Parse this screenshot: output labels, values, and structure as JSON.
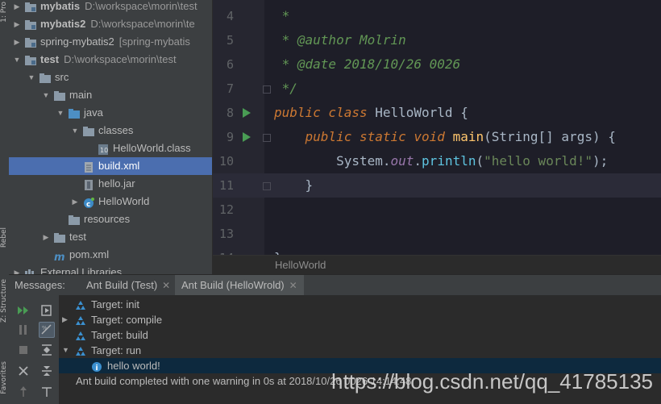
{
  "left_strip": {
    "top_label": "1: Pro",
    "middle_label": "Z: Structure",
    "bottom_label": "Favorites",
    "maven_label": "Rebel"
  },
  "project_tree": [
    {
      "label": "mybatis",
      "path": "D:\\workspace\\morin\\test",
      "icon": "module-folder-icon",
      "indent": 0,
      "expanded": false,
      "bold": true
    },
    {
      "label": "mybatis2",
      "path": "D:\\workspace\\morin\\te",
      "icon": "module-folder-icon",
      "indent": 0,
      "expanded": false,
      "bold": true
    },
    {
      "label": "spring-mybatis2",
      "path": "[spring-mybatis",
      "icon": "module-folder-icon",
      "indent": 0,
      "expanded": false,
      "bold": false
    },
    {
      "label": "test",
      "path": "D:\\workspace\\morin\\test",
      "icon": "module-folder-icon",
      "indent": 0,
      "expanded": true,
      "bold": true
    },
    {
      "label": "src",
      "path": "",
      "icon": "folder-icon",
      "indent": 1,
      "expanded": true
    },
    {
      "label": "main",
      "path": "",
      "icon": "folder-icon",
      "indent": 2,
      "expanded": true
    },
    {
      "label": "java",
      "path": "",
      "icon": "source-folder-icon",
      "indent": 3,
      "expanded": true
    },
    {
      "label": "classes",
      "path": "",
      "icon": "folder-icon",
      "indent": 4,
      "expanded": true
    },
    {
      "label": "HelloWorld.class",
      "path": "",
      "icon": "class-file-icon",
      "indent": 5,
      "expanded": null
    },
    {
      "label": "build.xml",
      "path": "",
      "icon": "ant-build-icon",
      "indent": 4,
      "expanded": null,
      "selected": true
    },
    {
      "label": "hello.jar",
      "path": "",
      "icon": "jar-icon",
      "indent": 4,
      "expanded": null
    },
    {
      "label": "HelloWorld",
      "path": "",
      "icon": "java-class-icon",
      "indent": 4,
      "expanded": false
    },
    {
      "label": "resources",
      "path": "",
      "icon": "folder-icon",
      "indent": 3,
      "expanded": null
    },
    {
      "label": "test",
      "path": "",
      "icon": "folder-icon",
      "indent": 2,
      "expanded": false
    },
    {
      "label": "pom.xml",
      "path": "",
      "icon": "maven-icon",
      "indent": 2,
      "expanded": null
    },
    {
      "label": "External Libraries",
      "path": "",
      "icon": "library-icon",
      "indent": 0,
      "expanded": false
    }
  ],
  "editor": {
    "lines": [
      {
        "n": "4",
        "tokens": [
          {
            "t": " *",
            "c": "cm-doc"
          }
        ]
      },
      {
        "n": "5",
        "tokens": [
          {
            "t": " * @author Molrin",
            "c": "cm-doc"
          }
        ]
      },
      {
        "n": "6",
        "tokens": [
          {
            "t": " * @date 2018/10/26 0026",
            "c": "cm-doc"
          }
        ]
      },
      {
        "n": "7",
        "tokens": [
          {
            "t": " */",
            "c": "cm-doc"
          }
        ],
        "fold": true
      },
      {
        "n": "8",
        "tokens": [
          {
            "t": "public class ",
            "c": "kw"
          },
          {
            "t": "HelloWorld {",
            "c": "plain"
          }
        ],
        "run": true
      },
      {
        "n": "9",
        "tokens": [
          {
            "t": "    public static void ",
            "c": "kw"
          },
          {
            "t": "main",
            "c": "fn"
          },
          {
            "t": "(String[] args) {",
            "c": "plain"
          }
        ],
        "run": true,
        "fold": true
      },
      {
        "n": "10",
        "tokens": [
          {
            "t": "        System.",
            "c": "plain"
          },
          {
            "t": "out",
            "c": "field"
          },
          {
            "t": ".",
            "c": "plain"
          },
          {
            "t": "println",
            "c": "method"
          },
          {
            "t": "(",
            "c": "plain"
          },
          {
            "t": "\"hello world!\"",
            "c": "str"
          },
          {
            "t": ");",
            "c": "plain"
          }
        ]
      },
      {
        "n": "11",
        "tokens": [
          {
            "t": "    }",
            "c": "plain"
          }
        ],
        "current": true,
        "fold": true
      },
      {
        "n": "12",
        "tokens": []
      },
      {
        "n": "13",
        "tokens": []
      },
      {
        "n": "14",
        "tokens": [
          {
            "t": "}",
            "c": "plain"
          }
        ]
      }
    ],
    "breadcrumb": "HelloWorld"
  },
  "messages": {
    "title": "Messages:",
    "tabs": [
      {
        "label": "Ant Build (Test)",
        "active": false
      },
      {
        "label": "Ant Build (HelloWrold)",
        "active": true
      }
    ],
    "rows": [
      {
        "text": "Target: init",
        "icon": "ant-target-icon",
        "indent": 0,
        "arrow": ""
      },
      {
        "text": "Target: compile",
        "icon": "ant-target-icon",
        "indent": 0,
        "arrow": "▶"
      },
      {
        "text": "Target: build",
        "icon": "ant-target-icon",
        "indent": 0,
        "arrow": ""
      },
      {
        "text": "Target: run",
        "icon": "ant-target-icon",
        "indent": 0,
        "arrow": "▼"
      },
      {
        "text": "hello world!",
        "icon": "info-icon",
        "indent": 1,
        "arrow": "",
        "selected": true
      },
      {
        "text": "Ant build completed with one warning in 0s at 2018/10/26 0026 14:14:48",
        "icon": "",
        "indent": -1,
        "arrow": ""
      }
    ]
  },
  "watermark": "https://blog.csdn.net/qq_41785135",
  "colors": {
    "selection": "#4b6eaf",
    "run_marker": "#499c54",
    "keyword": "#cc7832"
  }
}
